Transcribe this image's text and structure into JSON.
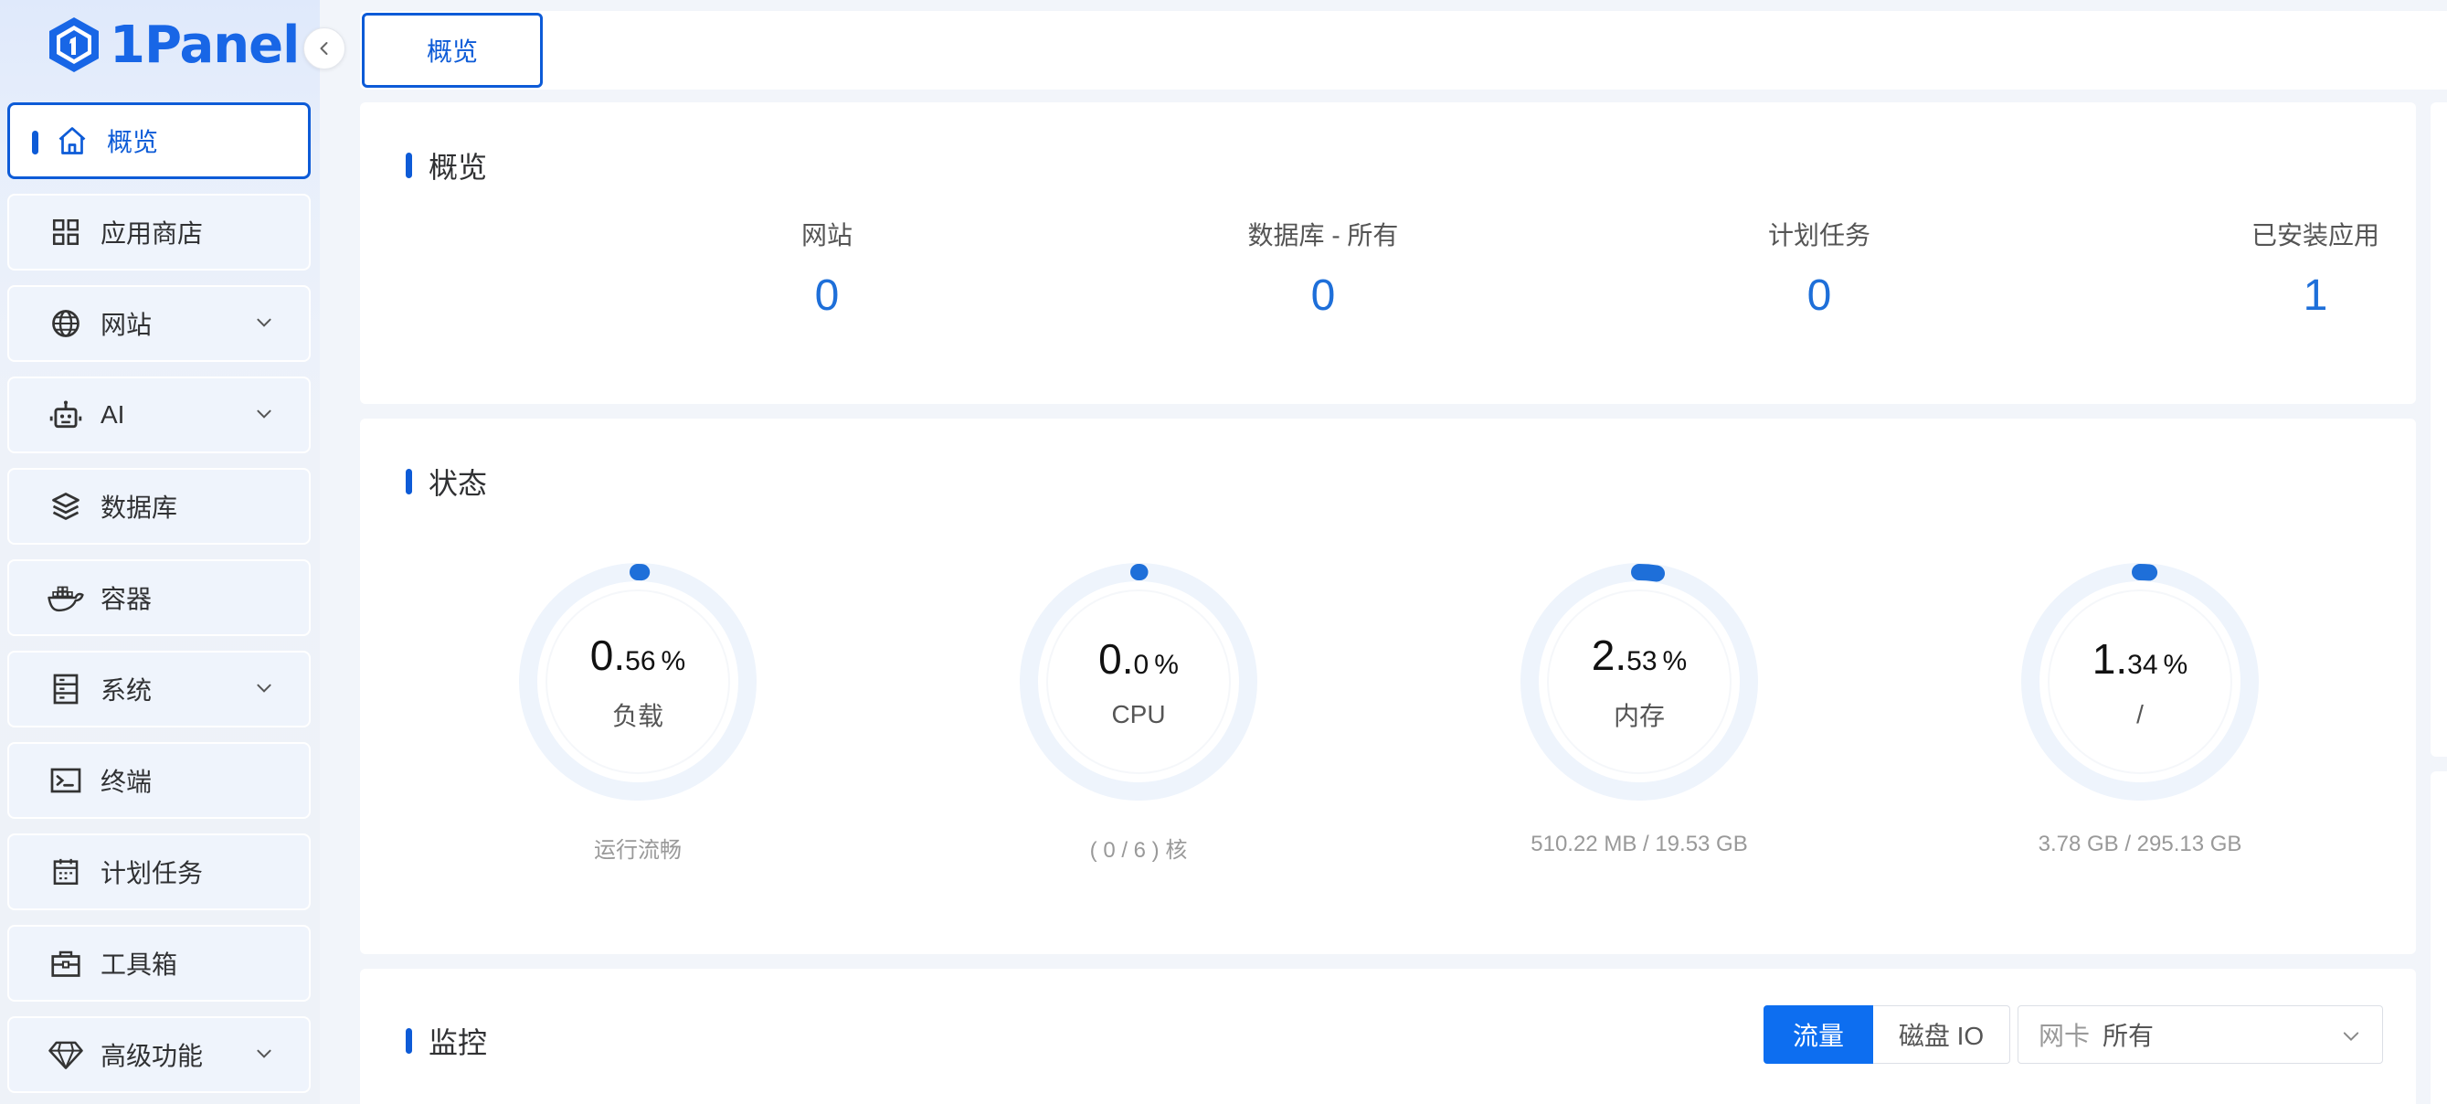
{
  "brand": {
    "name": "1Panel",
    "color": "#1866e6"
  },
  "sidebar": {
    "collapse_icon": "chevron-left-icon",
    "items": [
      {
        "label": "概览",
        "icon": "home-icon",
        "active": true,
        "has_submenu": false
      },
      {
        "label": "应用商店",
        "icon": "grid-icon",
        "active": false,
        "has_submenu": false
      },
      {
        "label": "网站",
        "icon": "globe-icon",
        "active": false,
        "has_submenu": true
      },
      {
        "label": "AI",
        "icon": "robot-icon",
        "active": false,
        "has_submenu": true
      },
      {
        "label": "数据库",
        "icon": "layers-icon",
        "active": false,
        "has_submenu": false
      },
      {
        "label": "容器",
        "icon": "docker-icon",
        "active": false,
        "has_submenu": false
      },
      {
        "label": "系统",
        "icon": "server-icon",
        "active": false,
        "has_submenu": true
      },
      {
        "label": "终端",
        "icon": "terminal-icon",
        "active": false,
        "has_submenu": false
      },
      {
        "label": "计划任务",
        "icon": "calendar-icon",
        "active": false,
        "has_submenu": false
      },
      {
        "label": "工具箱",
        "icon": "toolbox-icon",
        "active": false,
        "has_submenu": false
      },
      {
        "label": "高级功能",
        "icon": "diamond-icon",
        "active": false,
        "has_submenu": true
      }
    ]
  },
  "tabs": [
    {
      "label": "概览",
      "active": true
    }
  ],
  "overview": {
    "title": "概览",
    "stats": [
      {
        "label": "网站",
        "value": "0"
      },
      {
        "label": "数据库 - 所有",
        "value": "0"
      },
      {
        "label": "计划任务",
        "value": "0"
      },
      {
        "label": "已安装应用",
        "value": "1"
      }
    ]
  },
  "status": {
    "title": "状态",
    "gauges": [
      {
        "int": "0.",
        "frac": "56",
        "unit": "%",
        "name": "负载",
        "detail": "运行流畅",
        "percent": 0.56
      },
      {
        "int": "0.",
        "frac": "0",
        "unit": "%",
        "name": "CPU",
        "detail": "( 0 / 6 ) 核",
        "percent": 0.0
      },
      {
        "int": "2.",
        "frac": "53",
        "unit": "%",
        "name": "内存",
        "detail": "510.22 MB / 19.53 GB",
        "percent": 2.53
      },
      {
        "int": "1.",
        "frac": "34",
        "unit": "%",
        "name": "/",
        "detail": "3.78 GB / 295.13 GB",
        "percent": 1.34
      }
    ]
  },
  "monitor": {
    "title": "监控",
    "seg_traffic": "流量",
    "seg_disk": "磁盘 IO",
    "nic_label": "网卡",
    "nic_value": "所有"
  },
  "colors": {
    "accent": "#0d5bd7",
    "value_blue": "#1e6fd9",
    "gauge_track": "#eef4fc"
  }
}
